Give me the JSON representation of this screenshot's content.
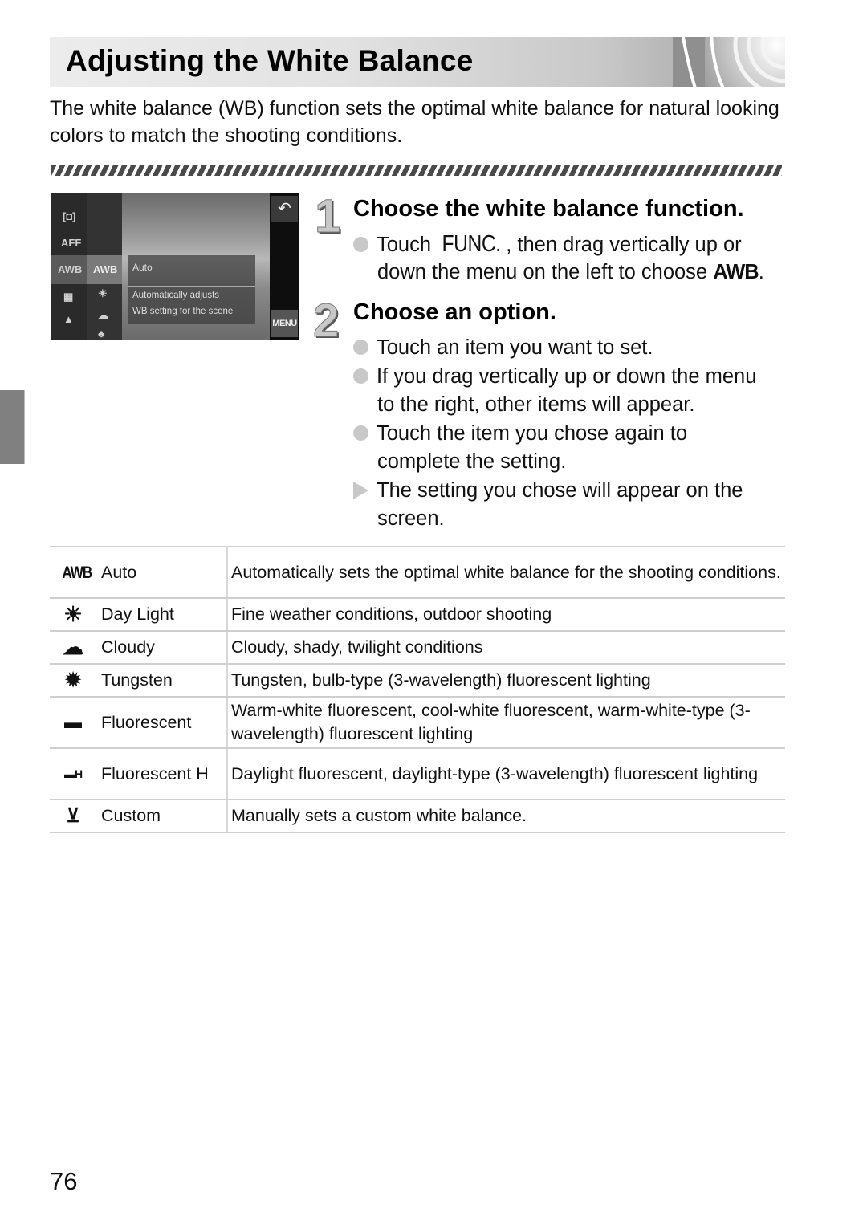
{
  "page": {
    "title": "Adjusting the White Balance",
    "intro": "The white balance (WB) function sets the optimal white balance for natural looking colors to match the shooting conditions.",
    "page_number": "76"
  },
  "camera_screen": {
    "left_icons": [
      "[◘]",
      "AFF",
      "AWB",
      "▦",
      "▲"
    ],
    "sub_icons": [
      "AWB",
      "☀",
      "☁",
      "♣"
    ],
    "option_title": "Auto",
    "option_desc_line1": "Automatically adjusts",
    "option_desc_line2": "WB setting for the scene",
    "back_icon": "↶",
    "menu_label": "MENU"
  },
  "steps": [
    {
      "number": "1",
      "title": "Choose the white balance function.",
      "bullets": [
        {
          "type": "dot",
          "before": "Touch ",
          "icon": "FUNC.",
          "after": ", then drag vertically up or",
          "line2_before": "down the menu on the left to choose ",
          "line2_icon": "AWB",
          "line2_after": "."
        }
      ]
    },
    {
      "number": "2",
      "title": "Choose an option.",
      "bullets": [
        {
          "type": "dot",
          "line1": "Touch an item you want to set."
        },
        {
          "type": "dot",
          "line1": "If you drag vertically up or down the menu",
          "line2": "to the right, other items will appear."
        },
        {
          "type": "dot",
          "line1": "Touch the item you chose again to",
          "line2": "complete the setting."
        },
        {
          "type": "triangle",
          "line1": "The setting you chose will appear on the",
          "line2": "screen."
        }
      ]
    }
  ],
  "table": {
    "rows": [
      {
        "icon": "awb-icon",
        "glyph": "AWB",
        "label": "Auto",
        "description": "Automatically sets the optimal white balance for the shooting conditions."
      },
      {
        "icon": "daylight-icon",
        "glyph": "☀",
        "label": "Day Light",
        "description": "Fine weather conditions, outdoor shooting"
      },
      {
        "icon": "cloudy-icon",
        "glyph": "☁",
        "label": "Cloudy",
        "description": "Cloudy, shady, twilight conditions"
      },
      {
        "icon": "tungsten-icon",
        "glyph": "✹",
        "label": "Tungsten",
        "description": "Tungsten, bulb-type (3-wavelength) fluorescent lighting"
      },
      {
        "icon": "fluorescent-icon",
        "glyph": "▬",
        "label": "Fluorescent",
        "description": "Warm-white fluorescent, cool-white fluorescent, warm-white-type (3-wavelength) fluorescent lighting"
      },
      {
        "icon": "fluorescent-h-icon",
        "glyph": "▬H",
        "label": "Fluorescent H",
        "description": "Daylight fluorescent, daylight-type (3-wavelength) fluorescent lighting"
      },
      {
        "icon": "custom-wb-icon",
        "glyph": "⊻",
        "label": "Custom",
        "description": "Manually sets a custom white balance."
      }
    ]
  }
}
